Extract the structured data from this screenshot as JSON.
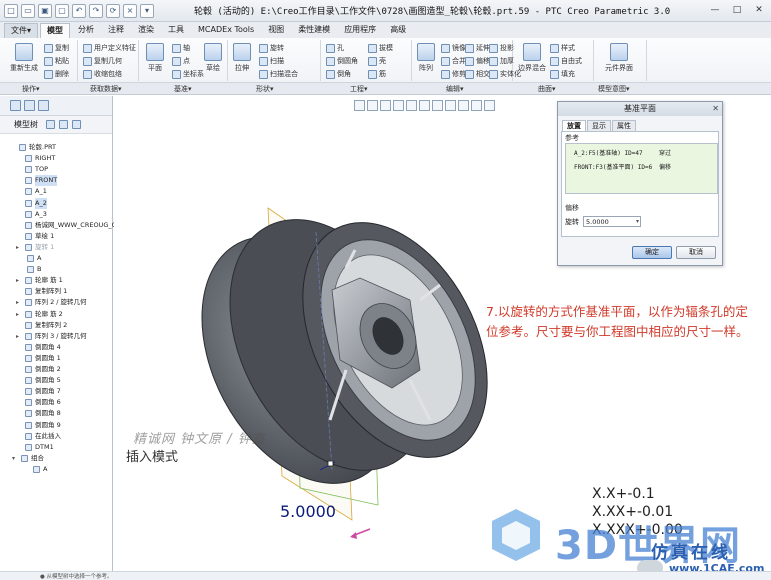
{
  "window": {
    "title": "轮毂 (活动的) E:\\Creo工作目录\\工作文件\\0728\\画图造型_轮毂\\轮毂.prt.59 - PTC Creo Parametric 3.0"
  },
  "ribbon": {
    "tabs": [
      "文件▾",
      "模型",
      "分析",
      "注释",
      "渲染",
      "工具",
      "MCADEx Tools",
      "视图",
      "柔性建模",
      "应用程序",
      "高级"
    ],
    "active_tab": "模型",
    "commands": {
      "regen": "重新生成",
      "copy": "复制",
      "paste": "粘贴",
      "delete": "删除",
      "udf": "用户定义特征",
      "copy_geom": "复制几何",
      "shrinkwrap": "收缩包络",
      "plane": "平面",
      "axis": "轴",
      "point": "点",
      "csys": "坐标系",
      "sketch": "草绘",
      "extrude": "拉伸",
      "revolve": "旋转",
      "sweep": "扫描",
      "sweep_blend": "扫描混合",
      "hole": "孔",
      "round": "倒圆角",
      "chamfer": "倒角",
      "draft": "拔模",
      "shell": "壳",
      "rib": "筋",
      "pattern": "阵列",
      "mirror": "镜像",
      "merge": "合并",
      "trim": "修剪",
      "extend": "延伸",
      "offset": "偏移",
      "intersect": "相交",
      "project": "投影",
      "thicken": "加厚",
      "solidify": "实体化",
      "boundary_blend": "边界混合",
      "style": "样式",
      "freestyle": "自由式",
      "fill": "填充",
      "model_intent": "元件界面"
    },
    "groups": [
      "操作▾",
      "获取数据▾",
      "基准▾",
      "形状▾",
      "工程▾",
      "编辑▾",
      "曲面▾",
      "模型意图▾"
    ]
  },
  "model_tree": {
    "header": "模型树",
    "items": [
      {
        "label": "轮毂.PRT",
        "expand": ""
      },
      {
        "label": "RIGHT",
        "expand": ""
      },
      {
        "label": "TOP",
        "expand": ""
      },
      {
        "label": "FRONT",
        "expand": "",
        "selected": true
      },
      {
        "label": "A_1",
        "expand": ""
      },
      {
        "label": "A_2",
        "expand": "",
        "selected": true
      },
      {
        "label": "A_3",
        "expand": ""
      },
      {
        "label": "杨诚网_WWW_CREOUG_C",
        "expand": ""
      },
      {
        "label": "草绘 1",
        "expand": ""
      },
      {
        "label": "旋转 1",
        "expand": "▸",
        "dim": true
      },
      {
        "label": "A",
        "expand": ""
      },
      {
        "label": "B",
        "expand": ""
      },
      {
        "label": "轮廓 筋 1",
        "expand": "▸"
      },
      {
        "label": "复制阵列 1",
        "expand": ""
      },
      {
        "label": "阵列 2 / 旋转几何",
        "expand": "▸"
      },
      {
        "label": "轮廓 筋 2",
        "expand": "▸"
      },
      {
        "label": "复制阵列 2",
        "expand": ""
      },
      {
        "label": "阵列 3 / 旋转几何",
        "expand": "▸"
      },
      {
        "label": "倒圆角 4",
        "expand": ""
      },
      {
        "label": "倒圆角 1",
        "expand": ""
      },
      {
        "label": "倒圆角 2",
        "expand": ""
      },
      {
        "label": "倒圆角 5",
        "expand": ""
      },
      {
        "label": "倒圆角 7",
        "expand": ""
      },
      {
        "label": "倒圆角 6",
        "expand": ""
      },
      {
        "label": "倒圆角 8",
        "expand": ""
      },
      {
        "label": "倒圆角 9",
        "expand": ""
      },
      {
        "label": "在此插入",
        "expand": ""
      },
      {
        "label": "DTM1",
        "expand": ""
      },
      {
        "label": "组合",
        "expand": "▾"
      },
      {
        "label": "A",
        "expand": ""
      }
    ]
  },
  "dialog": {
    "title": "基准平面",
    "tabs": [
      "放置",
      "显示",
      "属性"
    ],
    "active_tab": "放置",
    "refs_label": "参考",
    "refs": [
      {
        "name": "A_2:F5(基准轴) ID=47",
        "type": "穿过"
      },
      {
        "name": "FRONT:F3(基准平面) ID=6",
        "type": "偏移"
      }
    ],
    "offset_label": "偏移",
    "rotation_label": "旋转",
    "rotation_value": "5.0000",
    "ok": "确定",
    "cancel": "取消"
  },
  "graphics": {
    "annotation": "7.以旋转的方式作基准平面，以作为辐条孔的定位参考。尺寸要与你工程图中相应的尺寸一样。",
    "mode": "插入模式",
    "watermark": "精诚网 钟文原 / 钟鑫",
    "dimension": "5.0000",
    "tolerances": [
      "X.X+-0.1",
      "X.XX+-0.01",
      "X.XXX+-0.00"
    ],
    "logo_main": "3D世界网",
    "logo_sub": "仿真在线",
    "logo_url": "www.1CAE.com"
  },
  "status": {
    "text": "● 从模型树中选择一个参考。"
  }
}
